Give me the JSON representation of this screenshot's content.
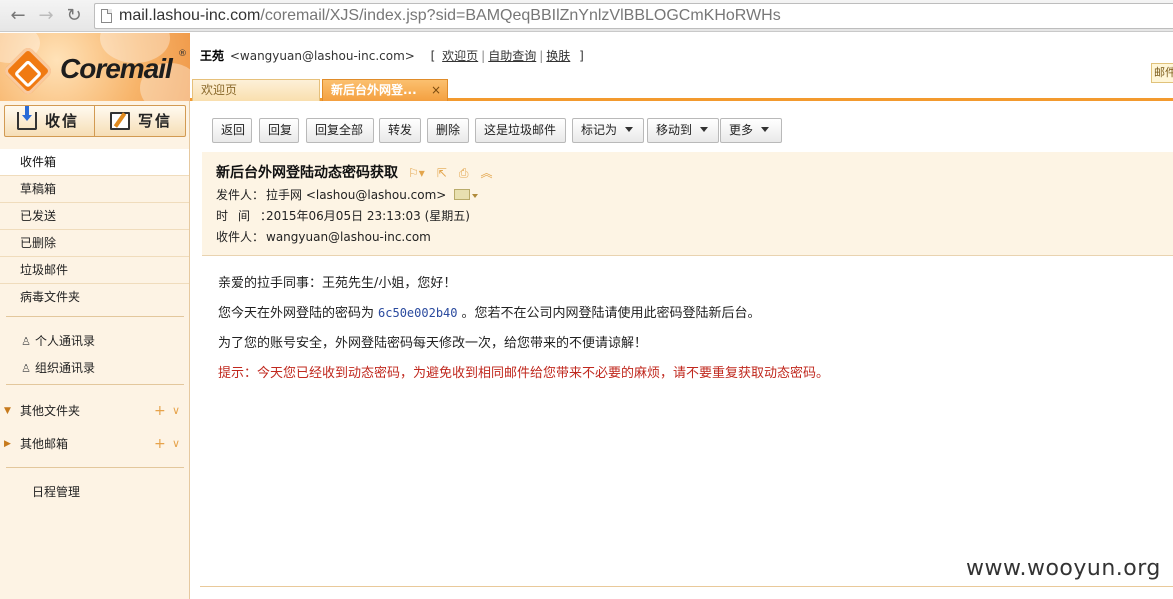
{
  "browser": {
    "url_host": "mail.lashou-inc.com",
    "url_path": "/coremail/XJS/index.jsp?sid=BAMQeqBBIlZnYnlzVlBBLOGCmKHoRWHs"
  },
  "header": {
    "brand": "Coremail",
    "registered": "®",
    "user_name": "王苑",
    "user_email": "<wangyuan@lashou-inc.com>",
    "bracket_open": "[",
    "bracket_close": "]",
    "links": [
      "欢迎页",
      "自助查询",
      "换肤"
    ],
    "side_tab": "邮件"
  },
  "tabs": [
    {
      "label": "欢迎页"
    },
    {
      "label": "新后台外网登...",
      "close": "×"
    }
  ],
  "sidebar": {
    "receive_label": "收信",
    "compose_label": "写信",
    "folders": [
      "收件箱",
      "草稿箱",
      "已发送",
      "已删除",
      "垃圾邮件",
      "病毒文件夹"
    ],
    "contacts": [
      "个人通讯录",
      "组织通讯录"
    ],
    "groups": [
      {
        "label": "其他文件夹"
      },
      {
        "label": "其他邮箱"
      }
    ],
    "plus": "+",
    "down": "∨",
    "calendar": "日程管理"
  },
  "toolbar": {
    "buttons": [
      "返回",
      "回复",
      "回复全部",
      "转发",
      "删除",
      "这是垃圾邮件"
    ],
    "dropdowns": [
      "标记为",
      "移动到",
      "更多"
    ]
  },
  "message": {
    "subject": "新后台外网登陆动态密码获取",
    "from_label": "发件人：",
    "from_value": "拉手网 <lashou@lashou.com>",
    "time_label": "时间：",
    "time_value": "2015年06月05日 23:13:03 (星期五)",
    "to_label": "收件人：",
    "to_value": "wangyuan@lashou-inc.com",
    "greeting": "亲爱的拉手同事：王苑先生/小姐，您好！",
    "line2_prefix": "您今天在外网登陆的密码为",
    "password": "6c50e002b40",
    "line2_suffix": "。您若不在公司内网登陆请使用此密码登陆新后台。",
    "line3": "为了您的账号安全，外网登陆密码每天修改一次，给您带来的不便请谅解！",
    "tip": "提示：今天您已经收到动态密码，为避免收到相同邮件给您带来不必要的麻烦，请不要重复获取动态密码。"
  },
  "watermark": "www.wooyun.org",
  "colors": {
    "accent_orange": "#f39a2e",
    "sidebar_bg": "#fdf3e4",
    "header_bg": "#fdf4e4",
    "tip_red": "#c0281e"
  }
}
